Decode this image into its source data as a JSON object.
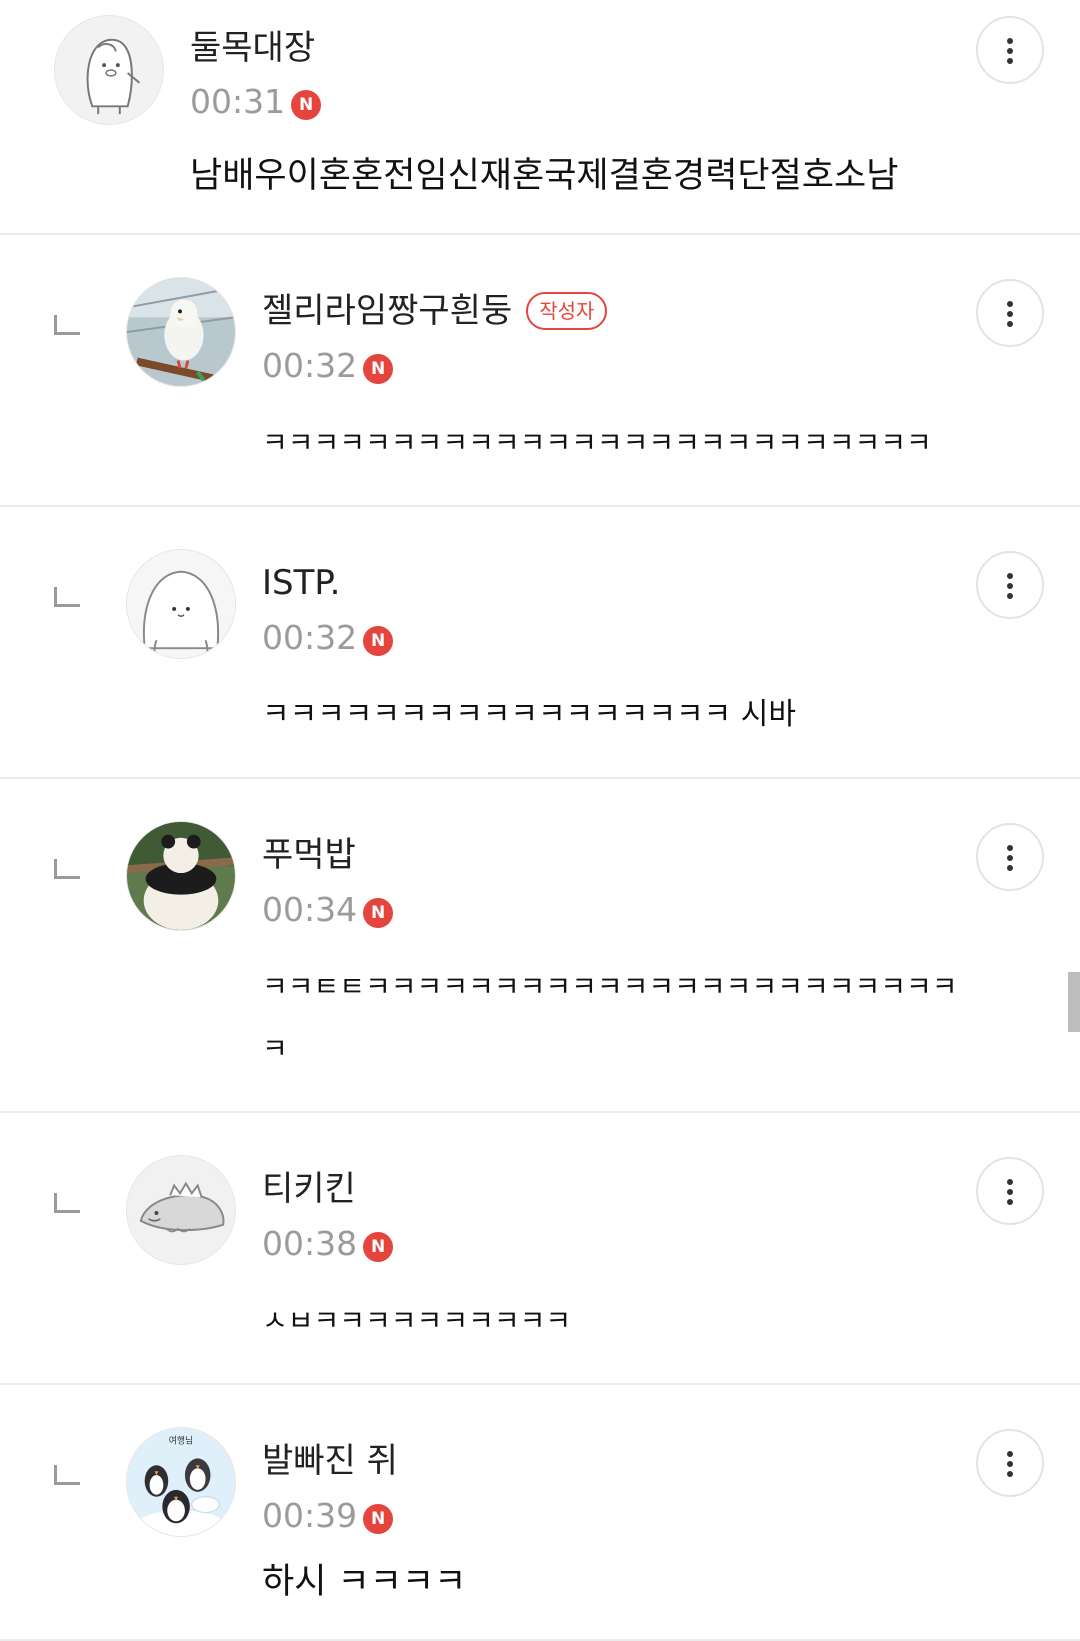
{
  "comments": [
    {
      "nickname": "둘목대장",
      "author_badge": "",
      "time": "00:31",
      "new_badge": "N",
      "text": "남배우이혼혼전임신재혼국제결혼경력단절호소남",
      "avatar_icon": "penguin-sketch-avatar",
      "is_reply": false
    },
    {
      "nickname": "젤리라임짱구흰둥",
      "author_badge": "작성자",
      "time": "00:32",
      "new_badge": "N",
      "text": "ㅋㅋㅋㅋㅋㅋㅋㅋㅋㅋㅋㅋㅋㅋㅋㅋㅋㅋㅋㅋㅋㅋㅋㅋㅋㅋ",
      "avatar_icon": "parrot-photo-avatar",
      "is_reply": true
    },
    {
      "nickname": "ISTP.",
      "author_badge": "",
      "time": "00:32",
      "new_badge": "N",
      "text": "ㅋㅋㅋㅋㅋㅋㅋㅋㅋㅋㅋㅋㅋㅋㅋㅋㅋ 시바",
      "avatar_icon": "seal-sketch-avatar",
      "is_reply": true
    },
    {
      "nickname": "푸먹밥",
      "author_badge": "",
      "time": "00:34",
      "new_badge": "N",
      "text": "ㅋㅋㅌㅌㅋㅋㅋㅋㅋㅋㅋㅋㅋㅋㅋㅋㅋㅋㅋㅋㅋㅋㅋㅋㅋㅋㅋㅋ",
      "avatar_icon": "panda-photo-avatar",
      "is_reply": true
    },
    {
      "nickname": "티키킨",
      "author_badge": "",
      "time": "00:38",
      "new_badge": "N",
      "text": "ㅅㅂㅋㅋㅋㅋㅋㅋㅋㅋㅋㅋ",
      "avatar_icon": "dinosaur-sketch-avatar",
      "is_reply": true
    },
    {
      "nickname": "발빠진 쥐",
      "author_badge": "",
      "time": "00:39",
      "new_badge": "N",
      "text": "하시 ㅋㅋㅋㅋ",
      "avatar_icon": "penguin-toys-avatar",
      "avatar_label": "여행님",
      "is_reply": true
    }
  ],
  "more_icon": "vertical-dots-icon"
}
